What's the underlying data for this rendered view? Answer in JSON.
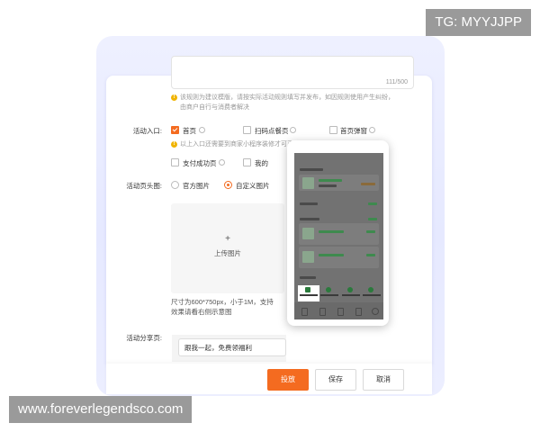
{
  "form": {
    "textarea_counter": "111/500",
    "rule_tip_line1": "该规则为建议模版，请按实际活动规则填写并发布，如因规则使用产生纠纷，",
    "rule_tip_line2": "由商户自行与消费者解决",
    "entry": {
      "label": "活动入口:",
      "options": [
        {
          "label": "首页",
          "checked": true
        },
        {
          "label": "扫码点餐页",
          "checked": false
        },
        {
          "label": "首页弹窗",
          "checked": false
        },
        {
          "label": "支付成功页",
          "checked": false
        },
        {
          "label": "我的",
          "checked": false
        }
      ],
      "tip": "以上入口还需要到商家小程序装修才可正常展示"
    },
    "header_image": {
      "label": "活动页头图:",
      "options": [
        {
          "label": "官方图片",
          "selected": false
        },
        {
          "label": "自定义图片",
          "selected": true
        }
      ],
      "upload_plus": "+",
      "upload_label": "上传图片",
      "size_tip_line1": "尺寸为600*750px，小于1M，支持",
      "size_tip_line2": "效果请看右侧示意图"
    },
    "share": {
      "label": "活动分享页:",
      "value": "跟我一起，免费领福利"
    }
  },
  "footer": {
    "publish": "投放",
    "save": "保存",
    "cancel": "取消"
  },
  "colors": {
    "accent": "#f46b20",
    "warning": "#f0b400"
  },
  "watermarks": {
    "top": "TG: MYYJJPP",
    "bottom": "www.foreverlegendsco.com"
  }
}
